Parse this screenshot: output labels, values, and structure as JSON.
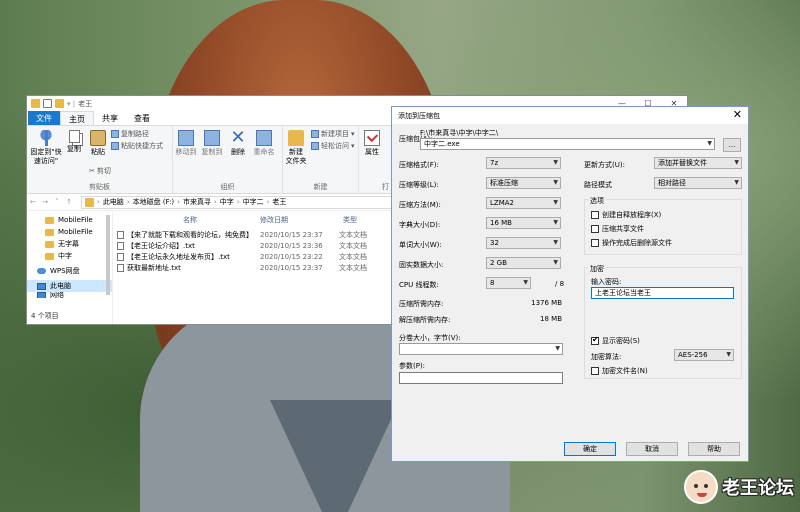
{
  "explorer": {
    "title": "老王",
    "window_controls": [
      "—",
      "☐",
      "✕"
    ],
    "tabs": [
      "文件",
      "主页",
      "共享",
      "查看"
    ],
    "ribbon": {
      "pin_label_1": "固定到\"快",
      "pin_label_2": "速访问\"",
      "copy": "复制",
      "paste": "粘贴",
      "copy_path": "复制路径",
      "paste_shortcut": "粘贴快捷方式",
      "cut": "剪切",
      "group_clipboard": "剪贴板",
      "move_to": "移动到",
      "copy_to": "复制到",
      "delete": "删除",
      "rename": "重命名",
      "group_organize": "组织",
      "new_folder_1": "新建",
      "new_folder_2": "文件夹",
      "new_item": "新建项目",
      "easy_access": "轻松访问",
      "group_new": "新建",
      "properties": "属性",
      "group_open_short": "打"
    },
    "address": [
      "此电脑",
      "本地磁盘 (F:)",
      "市来真寻",
      "中字",
      "中字二",
      "老王"
    ],
    "nav_items": [
      {
        "label": "MobileFile",
        "type": "folder"
      },
      {
        "label": "MobileFile",
        "type": "folder"
      },
      {
        "label": "无字幕",
        "type": "folder"
      },
      {
        "label": "中字",
        "type": "folder"
      },
      {
        "label": "WPS网盘",
        "type": "cloud"
      },
      {
        "label": "此电脑",
        "type": "pc"
      },
      {
        "label": "网络",
        "type": "net"
      }
    ],
    "columns": {
      "name": "名称",
      "date": "修改日期",
      "type": "类型"
    },
    "files": [
      {
        "name": "【来了就能下载和观看的论坛，纯免费】",
        "date": "2020/10/15 23:37",
        "type": "文本文档"
      },
      {
        "name": "【老王论坛介绍】.txt",
        "date": "2020/10/15 23:36",
        "type": "文本文档"
      },
      {
        "name": "【老王论坛永久地址发布页】.txt",
        "date": "2020/10/15 23:22",
        "type": "文本文档"
      },
      {
        "name": "获取最新地址.txt",
        "date": "2020/10/15 23:37",
        "type": "文本文档"
      }
    ],
    "status": "4 个项目"
  },
  "dialog": {
    "title": "添加到压缩包",
    "close": "✕",
    "archive_label": "压缩包(A):",
    "archive_path": "F:\\市来真寻\\中字\\中字二\\",
    "archive_name": "中字二.exe",
    "browse": "...",
    "format_label": "压缩格式(F):",
    "format_value": "7z",
    "level_label": "压缩等级(L):",
    "level_value": "标准压缩",
    "method_label": "压缩方法(M):",
    "method_value": "LZMA2",
    "dict_label": "字典大小(D):",
    "dict_value": "16 MB",
    "word_label": "单词大小(W):",
    "word_value": "32",
    "solid_label": "固实数据大小:",
    "solid_value": "2 GB",
    "threads_label": "CPU 线程数:",
    "threads_value": "8",
    "threads_max": "/ 8",
    "mem_compress_label": "压缩所需内存:",
    "mem_compress_value": "1376 MB",
    "mem_decompress_label": "解压缩所需内存:",
    "mem_decompress_value": "18 MB",
    "volume_label": "分卷大小，字节(V):",
    "volume_value": "",
    "params_label": "参数(P):",
    "params_value": "",
    "update_label": "更新方式(U):",
    "update_value": "添加并替换文件",
    "pathmode_label": "路径模式",
    "pathmode_value": "相对路径",
    "options_title": "选项",
    "opt_sfx": "创建自释放程序(X)",
    "opt_shared": "压缩共享文件",
    "opt_delete": "操作完成后删除源文件",
    "encrypt_title": "加密",
    "password_label": "输入密码:",
    "password_value": "上老王论坛当老王",
    "show_password": "显示密码(S)",
    "enc_method_label": "加密算法:",
    "enc_method_value": "AES-256",
    "enc_names": "加密文件名(N)",
    "ok": "确定",
    "cancel": "取消",
    "help": "帮助"
  },
  "watermark": "老王论坛"
}
